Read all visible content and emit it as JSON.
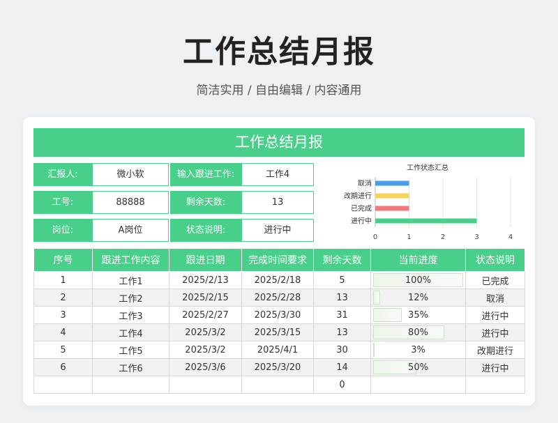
{
  "header": {
    "title": "工作总结月报",
    "subtitle": "简洁实用 / 自由编辑 / 内容通用"
  },
  "sheet": {
    "title": "工作总结月报",
    "info": {
      "reporter_label": "汇报人:",
      "reporter_value": "微小软",
      "input_work_label": "输入跟进工作:",
      "input_work_value": "工作4",
      "id_label": "工号:",
      "id_value": "88888",
      "days_left_label": "剩余天数:",
      "days_left_value": "13",
      "position_label": "岗位:",
      "position_value": "A岗位",
      "status_label": "状态说明:",
      "status_value": "进行中"
    }
  },
  "chart_data": {
    "type": "bar",
    "orientation": "horizontal",
    "title": "工作状态汇总",
    "categories": [
      "取消",
      "改期进行",
      "已完成",
      "进行中"
    ],
    "values": [
      1,
      1,
      1,
      3
    ],
    "colors": [
      "#4a9be8",
      "#f7d15a",
      "#f07a7a",
      "#48d08a"
    ],
    "xlim": [
      0,
      4
    ],
    "xticks": [
      "0",
      "1",
      "2",
      "3",
      "4"
    ],
    "grid": true
  },
  "table": {
    "headers": [
      "序号",
      "跟进工作内容",
      "跟进日期",
      "完成时间要求",
      "剩余天数",
      "当前进度",
      "状态说明"
    ],
    "rows": [
      {
        "no": "1",
        "task": "工作1",
        "date": "2025/2/13",
        "due": "2025/2/18",
        "days": "5",
        "progress": 1.0,
        "progress_label": "100%",
        "status": "已完成"
      },
      {
        "no": "2",
        "task": "工作2",
        "date": "2025/2/15",
        "due": "2025/2/28",
        "days": "13",
        "progress": 0.12,
        "progress_label": "12%",
        "status": "取消"
      },
      {
        "no": "3",
        "task": "工作3",
        "date": "2025/2/27",
        "due": "2025/3/30",
        "days": "31",
        "progress": 0.35,
        "progress_label": "35%",
        "status": "进行中"
      },
      {
        "no": "4",
        "task": "工作4",
        "date": "2025/3/2",
        "due": "2025/3/15",
        "days": "13",
        "progress": 0.8,
        "progress_label": "80%",
        "status": "进行中"
      },
      {
        "no": "5",
        "task": "工作5",
        "date": "2025/3/2",
        "due": "2025/4/1",
        "days": "30",
        "progress": 0.03,
        "progress_label": "3%",
        "status": "改期进行"
      },
      {
        "no": "6",
        "task": "工作6",
        "date": "2025/3/6",
        "due": "2025/3/20",
        "days": "14",
        "progress": 0.5,
        "progress_label": "50%",
        "status": "进行中"
      },
      {
        "no": "",
        "task": "",
        "date": "",
        "due": "",
        "days": "0",
        "progress": null,
        "progress_label": "",
        "status": ""
      }
    ]
  }
}
